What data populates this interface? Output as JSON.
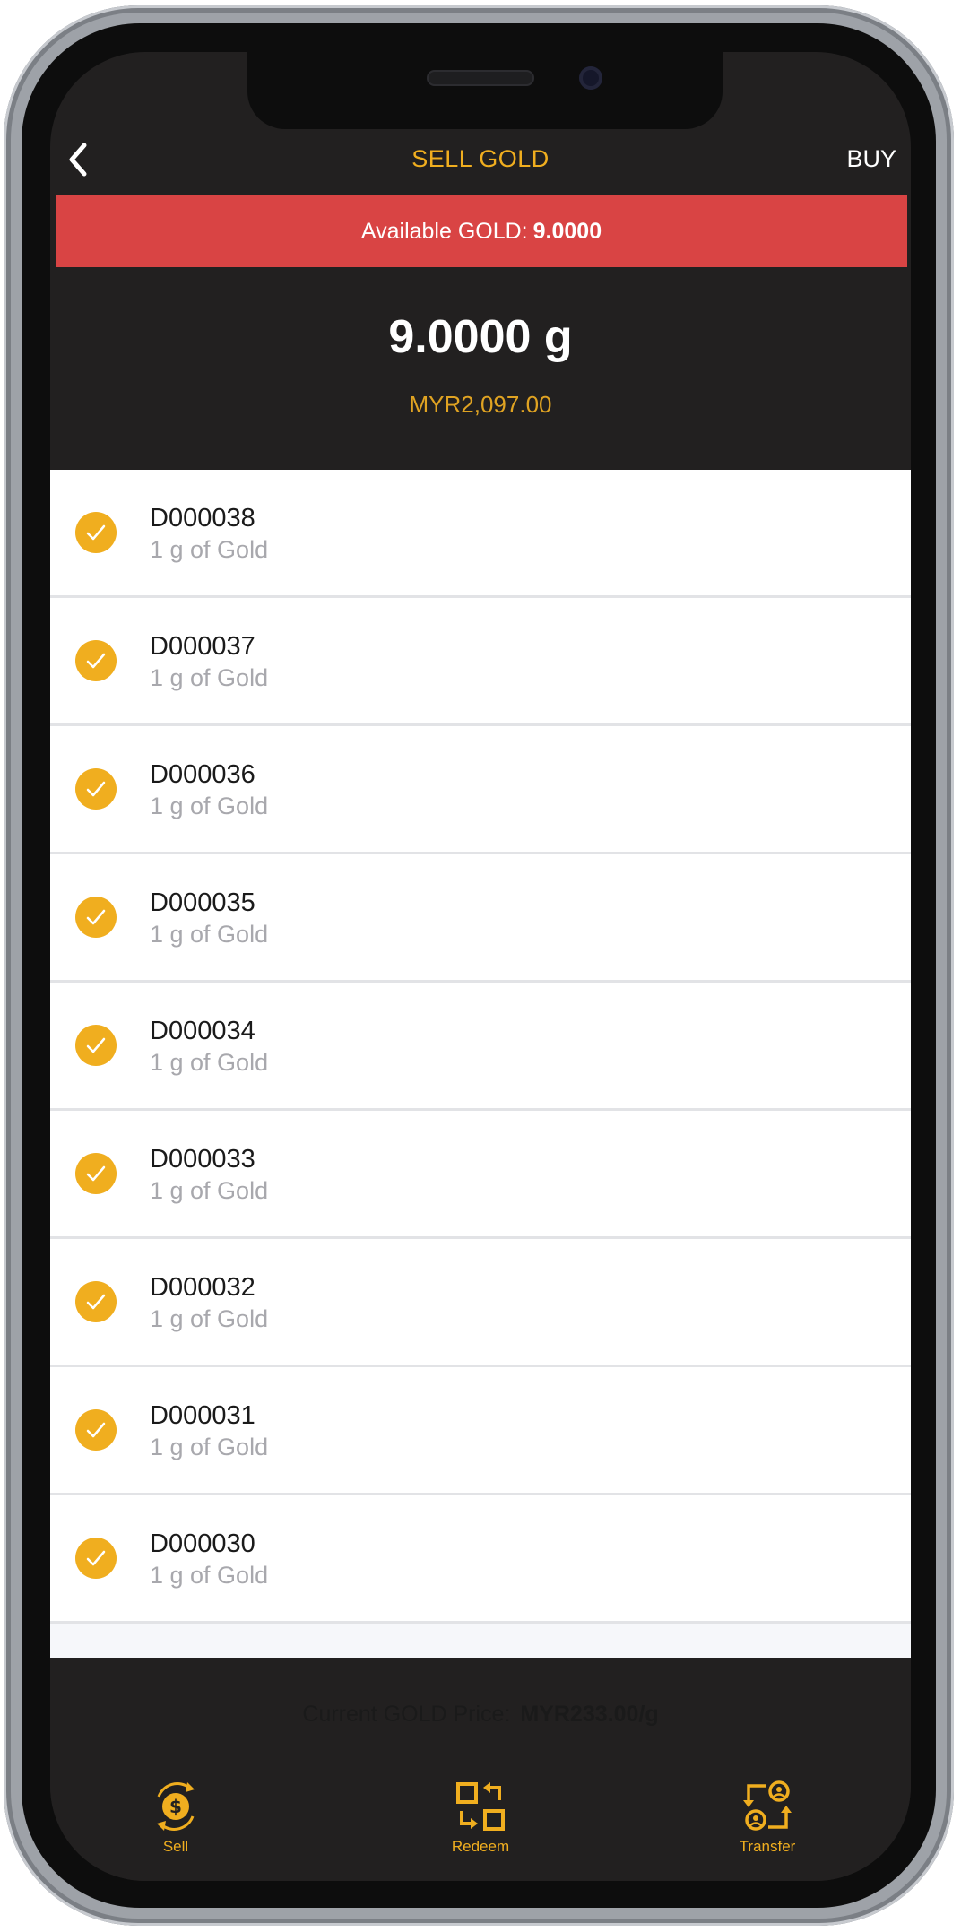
{
  "nav": {
    "title": "SELL GOLD",
    "buy_label": "BUY"
  },
  "available": {
    "label": "Available GOLD:",
    "value": "9.0000"
  },
  "summary": {
    "grams": "9.0000 g",
    "myr": "MYR2,097.00"
  },
  "items": [
    {
      "code": "D000038",
      "desc": "1 g of Gold"
    },
    {
      "code": "D000037",
      "desc": "1 g of Gold"
    },
    {
      "code": "D000036",
      "desc": "1 g of Gold"
    },
    {
      "code": "D000035",
      "desc": "1 g of Gold"
    },
    {
      "code": "D000034",
      "desc": "1 g of Gold"
    },
    {
      "code": "D000033",
      "desc": "1 g of Gold"
    },
    {
      "code": "D000032",
      "desc": "1 g of Gold"
    },
    {
      "code": "D000031",
      "desc": "1 g of Gold"
    },
    {
      "code": "D000030",
      "desc": "1 g of Gold"
    }
  ],
  "price": {
    "label": "Current GOLD Price:",
    "value": "MYR233.00/g"
  },
  "tabs": [
    {
      "label": "Sell",
      "icon": "dollar-cycle-icon"
    },
    {
      "label": "Redeem",
      "icon": "redeem-icon"
    },
    {
      "label": "Transfer",
      "icon": "transfer-icon"
    }
  ],
  "colors": {
    "accent": "#f0ae1f",
    "alert": "#d94444",
    "dark": "#222020"
  }
}
